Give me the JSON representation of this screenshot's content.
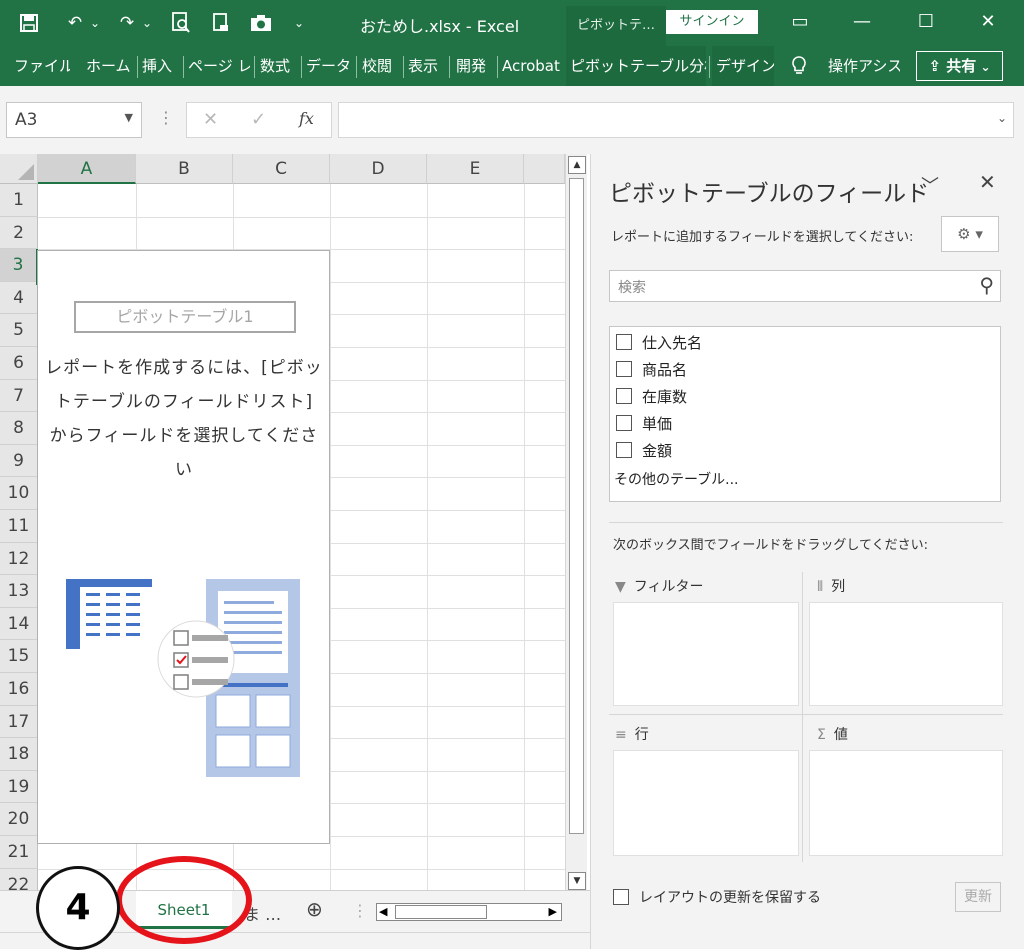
{
  "app": {
    "title": "おためし.xlsx  -  Excel",
    "context_tab_header": "ピボットテ…",
    "signin": "サインイン",
    "window_controls": {
      "ribbon_display": "▭",
      "minimize": "—",
      "maximize": "☐",
      "close": "✕"
    }
  },
  "qat": {
    "save": "💾",
    "undo": "↶",
    "undo_dd": "⌄",
    "redo": "↷",
    "redo_dd": "⌄",
    "print_preview": "🔍",
    "template": "🗎",
    "camera": "📷",
    "customize": "⌄"
  },
  "ribbon": {
    "tabs": [
      "ファイル",
      "ホーム",
      "挿入",
      "ページ レ",
      "数式",
      "データ",
      "校閲",
      "表示",
      "開発",
      "Acrobat",
      "ピボットテーブル分析",
      "デザイン"
    ],
    "tell_me": "操作アシス",
    "share": "共有"
  },
  "formula_bar": {
    "name_box": "A3",
    "cancel": "✕",
    "enter": "✓",
    "fx": "fx",
    "value": ""
  },
  "grid": {
    "columns": [
      "A",
      "B",
      "C",
      "D",
      "E"
    ],
    "rows": [
      "1",
      "2",
      "3",
      "4",
      "5",
      "6",
      "7",
      "8",
      "9",
      "10",
      "11",
      "12",
      "13",
      "14",
      "15",
      "16",
      "17",
      "18",
      "19",
      "20",
      "21",
      "22"
    ],
    "active_cell": "A3"
  },
  "pivot_placeholder": {
    "name": "ピボットテーブル1",
    "message": "レポートを作成するには、[ピボットテーブルのフィールドリスト] からフィールドを選択してください"
  },
  "sheets": {
    "active": "Sheet1",
    "more": "ま …",
    "add": "⊕"
  },
  "pivot_panel": {
    "title": "ピボットテーブルのフィールド",
    "instruction": "レポートに追加するフィールドを選択してください:",
    "search_placeholder": "検索",
    "fields": [
      "仕入先名",
      "商品名",
      "在庫数",
      "単価",
      "金額"
    ],
    "more_tables": "その他のテーブル...",
    "drag_instruction": "次のボックス間でフィールドをドラッグしてください:",
    "areas": {
      "filter": "フィルター",
      "columns": "列",
      "rows": "行",
      "values": "値"
    },
    "defer_update": "レイアウトの更新を保留する",
    "update": "更新"
  },
  "annotation": {
    "step": "4"
  },
  "colors": {
    "excel_green": "#217346",
    "annotation_red": "#e5141b"
  }
}
